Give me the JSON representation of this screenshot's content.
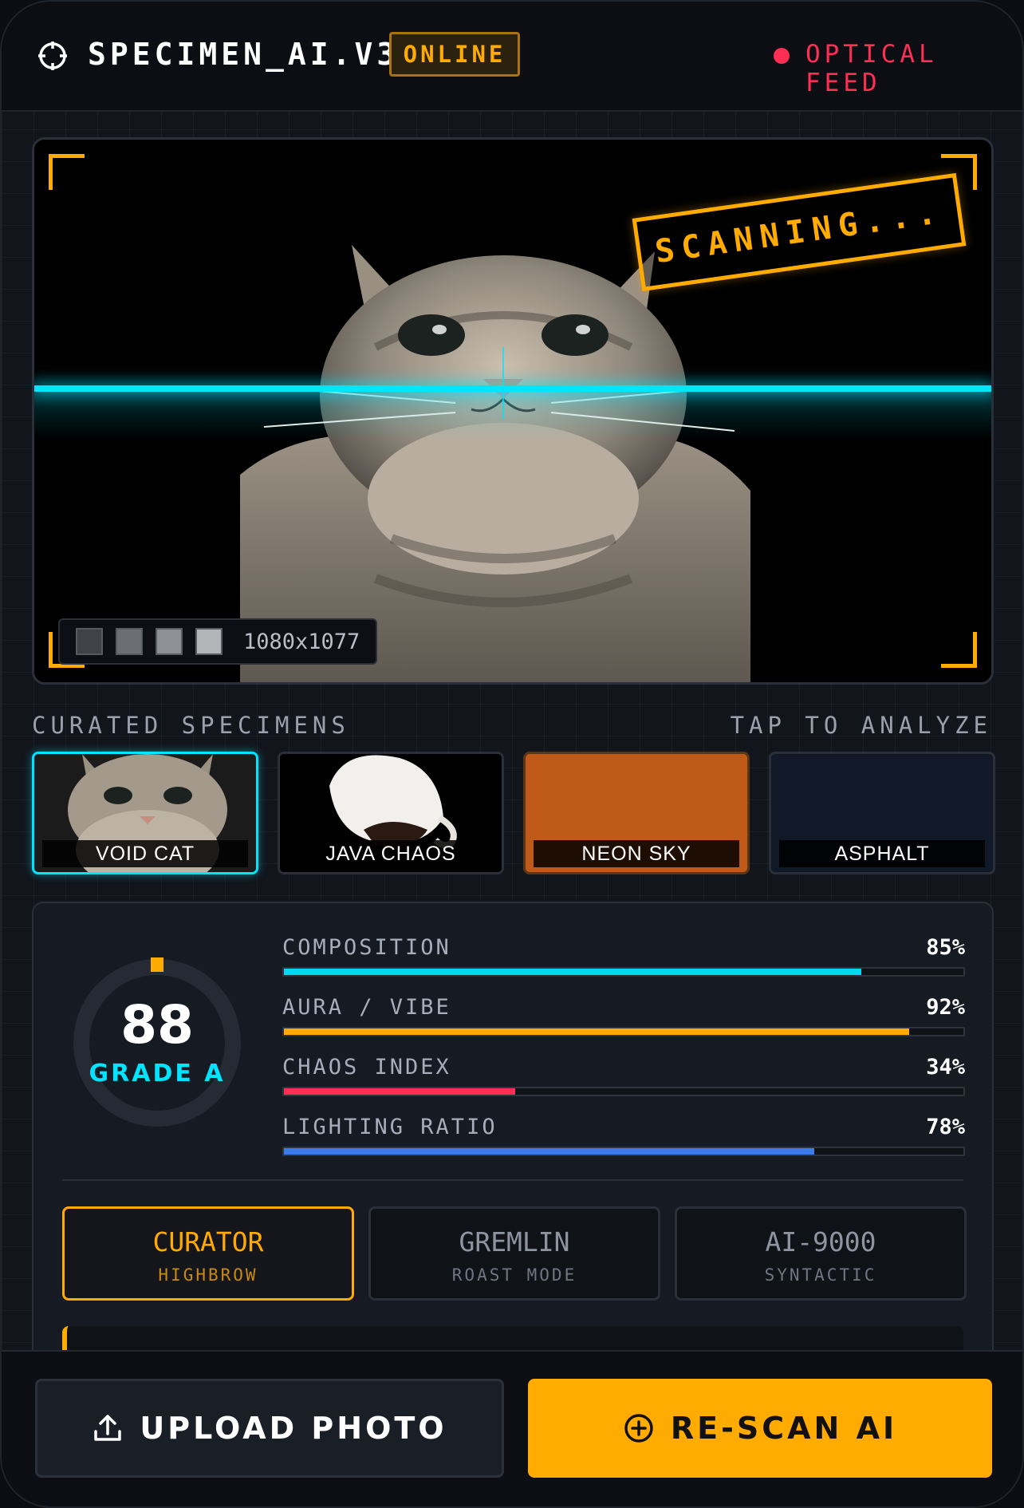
{
  "header": {
    "title": "SPECIMEN_AI.V3",
    "badge": "ONLINE",
    "feed_label": "OPTICAL FEED",
    "logo_icon": "crosshair-icon"
  },
  "viewer": {
    "scan_tag": "SCANNING...",
    "resolution": "1080x1077",
    "palette": [
      "#3f4247",
      "#6b6e73",
      "#8d9095",
      "#b3b5b8"
    ],
    "scanline_color": "#00e5ff"
  },
  "specimens": {
    "title": "CURATED SPECIMENS",
    "hint": "TAP TO ANALYZE",
    "items": [
      {
        "label": "VOID CAT",
        "active": true
      },
      {
        "label": "JAVA CHAOS",
        "active": false
      },
      {
        "label": "NEON SKY",
        "active": false
      },
      {
        "label": "ASPHALT",
        "active": false
      }
    ]
  },
  "analysis": {
    "score": "88",
    "grade": "GRADE A",
    "metrics": [
      {
        "label": "COMPOSITION",
        "value": "85%",
        "fraction": 0.85,
        "color": "#00d8f0"
      },
      {
        "label": "AURA / VIBE",
        "value": "92%",
        "fraction": 0.92,
        "color": "#ffab00"
      },
      {
        "label": "CHAOS INDEX",
        "value": "34%",
        "fraction": 0.34,
        "color": "#ff2e55"
      },
      {
        "label": "LIGHTING RATIO",
        "value": "78%",
        "fraction": 0.78,
        "color": "#3b7bf0"
      }
    ],
    "modes": [
      {
        "title": "CURATOR",
        "subtitle": "HIGHBROW",
        "active": true
      },
      {
        "title": "GREMLIN",
        "subtitle": "ROAST MODE",
        "active": false
      },
      {
        "title": "AI-9000",
        "subtitle": "SYNTACTIC",
        "active": false
      }
    ]
  },
  "actions": {
    "upload_label": "UPLOAD PHOTO",
    "upload_icon": "upload-icon",
    "rescan_label": "RE-SCAN AI",
    "rescan_icon": "plus-circle-icon"
  },
  "colors": {
    "accent": "#ffab00",
    "cyan": "#00e5ff",
    "alert": "#ff2e55"
  }
}
